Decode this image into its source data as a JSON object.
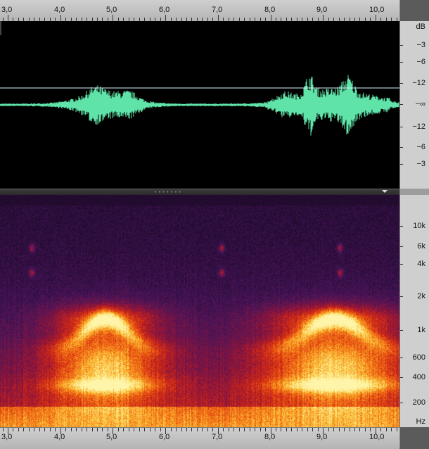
{
  "timeline": {
    "labels": [
      "3,0",
      "4,0",
      "5,0",
      "6,0",
      "7,0",
      "8,0",
      "9,0",
      "10,0"
    ]
  },
  "db_ruler": {
    "unit": "dB",
    "labels": [
      "−3",
      "−6",
      "−12",
      "−∞",
      "−12",
      "−6",
      "−3"
    ]
  },
  "hz_ruler": {
    "unit": "Hz",
    "labels": [
      "10k",
      "6k",
      "4k",
      "2k",
      "1k",
      "600",
      "400",
      "200"
    ]
  },
  "colors": {
    "waveform": "#5fe3a8",
    "threshold_line": "#d8f4ff",
    "background": "#000000"
  },
  "icons": {
    "divider_grip": "grip-dots-icon",
    "panel_menu": "dropdown-arrow-icon"
  }
}
